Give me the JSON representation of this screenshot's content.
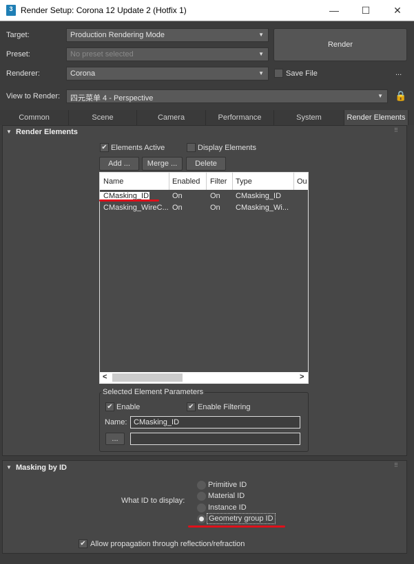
{
  "window": {
    "title": "Render Setup: Corona 12 Update 2 (Hotfix 1)",
    "app_icon": "3"
  },
  "top": {
    "target_label": "Target:",
    "target_value": "Production Rendering Mode",
    "preset_label": "Preset:",
    "preset_value": "No preset selected",
    "renderer_label": "Renderer:",
    "renderer_value": "Corona",
    "render_button": "Render",
    "save_file_label": "Save File",
    "more": "...",
    "view_label": "View to Render:",
    "view_value": "四元菜单 4 - Perspective"
  },
  "tabs": [
    "Common",
    "Scene",
    "Camera",
    "Performance",
    "System",
    "Render Elements"
  ],
  "render_elements": {
    "title": "Render Elements",
    "elements_active": "Elements Active",
    "display_elements": "Display Elements",
    "add": "Add ...",
    "merge": "Merge ...",
    "delete": "Delete",
    "columns": [
      "Name",
      "Enabled",
      "Filter",
      "Type",
      "Ou"
    ],
    "rows": [
      [
        "CMasking_ID",
        "On",
        "On",
        "CMasking_ID"
      ],
      [
        "CMasking_WireC...",
        "On",
        "On",
        "CMasking_Wi..."
      ]
    ],
    "scroll_left": "<",
    "scroll_right": ">",
    "params": {
      "title": "Selected Element Parameters",
      "enable": "Enable",
      "enable_filtering": "Enable Filtering",
      "name_label": "Name:",
      "name_value": "CMasking_ID",
      "browse": "..."
    }
  },
  "masking": {
    "title": "Masking by ID",
    "what_label": "What ID to display:",
    "options": [
      "Primitive ID",
      "Material ID",
      "Instance ID",
      "Geometry group ID"
    ],
    "selected": "Geometry group ID",
    "allow": "Allow propagation through reflection/refraction"
  }
}
